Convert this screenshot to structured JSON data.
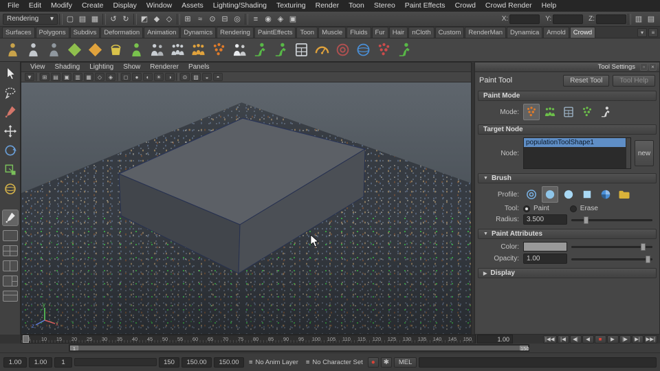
{
  "menubar": {
    "items": [
      "File",
      "Edit",
      "Modify",
      "Create",
      "Display",
      "Window",
      "Assets",
      "Lighting/Shading",
      "Texturing",
      "Render",
      "Toon",
      "Stereo",
      "Paint Effects",
      "Crowd",
      "Crowd Render",
      "Help"
    ]
  },
  "status": {
    "menu_mode": "Rendering",
    "menu_arrow": "▾",
    "icons": [
      {
        "name": "new-scene-icon",
        "g": "▢"
      },
      {
        "name": "open-scene-icon",
        "g": "▤"
      },
      {
        "name": "save-scene-icon",
        "g": "▦"
      },
      {
        "name": "divider",
        "div": true,
        "g": ""
      },
      {
        "name": "undo-icon",
        "g": "↺"
      },
      {
        "name": "redo-icon",
        "g": "↻"
      },
      {
        "name": "divider",
        "div": true,
        "g": ""
      },
      {
        "name": "select-hierarchy-icon",
        "g": "◩"
      },
      {
        "name": "select-object-icon",
        "g": "◆"
      },
      {
        "name": "select-component-icon",
        "g": "◇"
      },
      {
        "name": "divider",
        "div": true,
        "g": ""
      },
      {
        "name": "snap-grid-icon",
        "g": "⊞"
      },
      {
        "name": "snap-curve-icon",
        "g": "≈"
      },
      {
        "name": "snap-point-icon",
        "g": "⊙"
      },
      {
        "name": "snap-plane-icon",
        "g": "⊟"
      },
      {
        "name": "make-live-icon",
        "g": "◎"
      },
      {
        "name": "divider",
        "div": true,
        "g": ""
      },
      {
        "name": "history-icon",
        "g": "≡"
      },
      {
        "name": "render-current-icon",
        "g": "◉"
      },
      {
        "name": "ipr-render-icon",
        "g": "◈"
      },
      {
        "name": "render-settings-icon",
        "g": "▣"
      }
    ],
    "x_label": "X:",
    "y_label": "Y:",
    "z_label": "Z:",
    "x_value": "",
    "y_value": "",
    "z_value": "",
    "right_icons": [
      {
        "name": "show-sidebar-icon",
        "g": "▥"
      },
      {
        "name": "hide-sidebar-icon",
        "g": "▤"
      }
    ]
  },
  "shelf": {
    "tabs": [
      {
        "label": "Surfaces"
      },
      {
        "label": "Polygons"
      },
      {
        "label": "Subdivs"
      },
      {
        "label": "Deformation"
      },
      {
        "label": "Animation"
      },
      {
        "label": "Dynamics"
      },
      {
        "label": "Rendering"
      },
      {
        "label": "PaintEffects"
      },
      {
        "label": "Toon"
      },
      {
        "label": "Muscle"
      },
      {
        "label": "Fluids"
      },
      {
        "label": "Fur"
      },
      {
        "label": "Hair"
      },
      {
        "label": "nCloth"
      },
      {
        "label": "Custom"
      },
      {
        "label": "RenderMan"
      },
      {
        "label": "Dynamica"
      },
      {
        "label": "Arnold"
      },
      {
        "label": "Crowd",
        "active": true
      }
    ],
    "tab_buttons": [
      {
        "name": "shelf-menu-icon",
        "g": "▾"
      },
      {
        "name": "shelf-editor-icon",
        "g": "≡"
      }
    ],
    "icons": [
      {
        "name": "crowd-man-icon",
        "sym": "sym-person",
        "c": "#c8a24a"
      },
      {
        "name": "crowd-character-icon",
        "sym": "sym-person",
        "c": "#c3c8cd"
      },
      {
        "name": "crowd-skeleton-icon",
        "sym": "sym-person",
        "c": "#8f979e"
      },
      {
        "name": "terrain-diamond-icon",
        "sym": "sym-diamond",
        "c": "#8fbf4d"
      },
      {
        "name": "ground-diamond-icon",
        "sym": "sym-diamond",
        "c": "#e0a23c"
      },
      {
        "name": "paint-bucket-icon",
        "sym": "sym-bucket",
        "c": "#d9c24a"
      },
      {
        "name": "entity-green-icon",
        "sym": "sym-person",
        "c": "#79c24d"
      },
      {
        "name": "people-pair-icon",
        "sym": "sym-people",
        "c": "#c9ced3"
      },
      {
        "name": "people-group-icon",
        "sym": "sym-trio",
        "c": "#c9ced3"
      },
      {
        "name": "population-people-icon",
        "sym": "sym-trio",
        "c": "#e0a23c"
      },
      {
        "name": "dots-sphere-icon",
        "sym": "sym-dots",
        "c": "#e07b2a"
      },
      {
        "name": "people-white-icon",
        "sym": "sym-people",
        "c": "#e9ebee"
      },
      {
        "name": "walker-icon",
        "sym": "sym-runner",
        "c": "#58b847"
      },
      {
        "name": "runner-icon",
        "sym": "sym-runner",
        "c": "#58b847"
      },
      {
        "name": "calc-sheet-icon",
        "sym": "sym-calc",
        "c": "#ccd1d6"
      },
      {
        "name": "gauge-icon",
        "sym": "sym-gauge",
        "c": "#e0a23c"
      },
      {
        "name": "target-rings-icon",
        "sym": "sym-target",
        "c": "#b05050"
      },
      {
        "name": "sphere-orbit-icon",
        "sym": "sym-sphere",
        "c": "#4a90d9"
      },
      {
        "name": "burst-icon",
        "sym": "sym-dots",
        "c": "#cc4b4b"
      },
      {
        "name": "runner-trio-icon",
        "sym": "sym-runner",
        "c": "#58b847"
      }
    ]
  },
  "toolbox": {
    "tools": [
      {
        "name": "select-tool-icon",
        "sym": "sym-cursor",
        "c": "#e8e8e8"
      },
      {
        "name": "lasso-tool-icon",
        "sym": "sym-lasso",
        "c": "#dcdcdc"
      },
      {
        "name": "paint-select-tool-icon",
        "sym": "sym-brush",
        "c": "#d4766a"
      },
      {
        "name": "move-tool-icon",
        "sym": "sym-move",
        "c": "#d8d8d8"
      },
      {
        "name": "rotate-tool-icon",
        "sym": "sym-rotate",
        "c": "#6a9fd8"
      },
      {
        "name": "scale-tool-icon",
        "sym": "sym-scale",
        "c": "#7abf5a"
      },
      {
        "name": "universal-manip-tool-icon",
        "sym": "sym-sphere",
        "c": "#d8b54a"
      }
    ]
  },
  "viewport": {
    "menus": [
      "View",
      "Shading",
      "Lighting",
      "Show",
      "Renderer",
      "Panels"
    ],
    "toolbar": [
      {
        "name": "camera-menu-icon",
        "g": "▼"
      },
      {
        "name": "divider",
        "div": true,
        "g": ""
      },
      {
        "name": "grid-toggle-icon",
        "g": "⊞"
      },
      {
        "name": "film-gate-icon",
        "g": "▤"
      },
      {
        "name": "resolution-gate-icon",
        "g": "▣"
      },
      {
        "name": "gate-mask-icon",
        "g": "▥"
      },
      {
        "name": "field-chart-icon",
        "g": "▦"
      },
      {
        "name": "safe-action-icon",
        "g": "◇"
      },
      {
        "name": "safe-title-icon",
        "g": "◈"
      },
      {
        "name": "divider",
        "div": true,
        "g": ""
      },
      {
        "name": "wireframe-icon",
        "g": "◻"
      },
      {
        "name": "shaded-icon",
        "g": "●"
      },
      {
        "name": "textured-icon",
        "g": "◐"
      },
      {
        "name": "lights-icon",
        "g": "☀"
      },
      {
        "name": "shadows-icon",
        "g": "◑"
      },
      {
        "name": "divider",
        "div": true,
        "g": ""
      },
      {
        "name": "isolate-select-icon",
        "g": "⊙"
      },
      {
        "name": "xray-icon",
        "g": "▨"
      },
      {
        "name": "exposure-icon",
        "g": "◒"
      },
      {
        "name": "gamma-icon",
        "g": "◓"
      }
    ],
    "axis": {
      "x": "x",
      "y": "y",
      "z": "z"
    }
  },
  "tool_settings": {
    "window_title": "Tool Settings",
    "window_icons": [
      {
        "name": "restore-icon",
        "g": "▫"
      },
      {
        "name": "close-icon",
        "g": "×"
      }
    ],
    "tool_title": "Paint Tool",
    "reset_button": "Reset Tool",
    "help_button": "Tool Help",
    "paint_mode": {
      "header": "Paint Mode",
      "mode_label": "Mode:",
      "icons": [
        {
          "name": "paint-mode-place-icon",
          "sym": "sym-dots",
          "c": "#e07b2a",
          "active": true
        },
        {
          "name": "paint-mode-people-icon",
          "sym": "sym-trio",
          "c": "#6cbf4a"
        },
        {
          "name": "paint-mode-table-icon",
          "sym": "sym-calc",
          "c": "#9fb6c9"
        },
        {
          "name": "paint-mode-scatter-icon",
          "sym": "sym-dots",
          "c": "#6cbf4a"
        },
        {
          "name": "paint-mode-ball-icon",
          "sym": "sym-runner",
          "c": "#d8d8d8"
        }
      ]
    },
    "target_node": {
      "header": "Target Node",
      "node_label": "Node:",
      "selected_node": "populationToolShape1",
      "new_button": "new"
    },
    "brush": {
      "header": "Brush",
      "profile_label": "Profile:",
      "profile_icons": [
        {
          "name": "brush-gaussian-icon",
          "sym": "sym-target",
          "c": "#7ab4e8"
        },
        {
          "name": "brush-soft-icon",
          "sym": "sym-circle",
          "c": "#8fc6ea",
          "active": true
        },
        {
          "name": "brush-solid-icon",
          "sym": "sym-circle",
          "c": "#a8d8f4"
        },
        {
          "name": "brush-square-icon",
          "sym": "sym-square",
          "c": "#a8d8f4"
        },
        {
          "name": "brush-colorwheel-icon",
          "sym": "sym-wheel",
          "c": "#4a90d9"
        },
        {
          "name": "browse-folder-icon",
          "sym": "sym-folder",
          "c": "#d9b23a"
        }
      ],
      "tool_label": "Tool:",
      "paint_radio": "Paint",
      "erase_radio": "Erase",
      "radius_label": "Radius:",
      "radius_value": "3.500"
    },
    "paint_attributes": {
      "header": "Paint Attributes",
      "color_label": "Color:",
      "opacity_label": "Opacity:",
      "opacity_value": "1.00"
    },
    "display": {
      "header": "Display"
    }
  },
  "timeline": {
    "ticks": [
      5,
      10,
      15,
      20,
      25,
      30,
      35,
      40,
      45,
      50,
      55,
      60,
      65,
      70,
      75,
      80,
      85,
      90,
      95,
      100,
      105,
      110,
      115,
      120,
      125,
      130,
      135,
      140,
      145,
      150
    ],
    "current_time": "1.00"
  },
  "playback": {
    "buttons": [
      {
        "name": "go-to-start-button",
        "g": "|◀◀"
      },
      {
        "name": "step-back-key-button",
        "g": "|◀"
      },
      {
        "name": "step-back-frame-button",
        "g": "◀|"
      },
      {
        "name": "play-backwards-button",
        "g": "◀"
      },
      {
        "name": "record-button",
        "g": "■",
        "red": true
      },
      {
        "name": "play-forwards-button",
        "g": "▶"
      },
      {
        "name": "step-fwd-frame-button",
        "g": "|▶"
      },
      {
        "name": "step-fwd-key-button",
        "g": "▶|"
      },
      {
        "name": "go-to-end-button",
        "g": "▶▶|"
      }
    ]
  },
  "range": {
    "handle_start": "1",
    "handle_end": "150"
  },
  "bottom": {
    "anim_start": "1.00",
    "playback_start": "1.00",
    "range_start": "1",
    "range_end": "150",
    "playback_end": "150.00",
    "anim_end": "150.00",
    "anim_layer": "No Anim Layer",
    "char_set": "No Character Set",
    "menu_icon": "≡",
    "autokey_icon": "●",
    "prefs_icon": "✱",
    "mel_label": "MEL",
    "command_value": ""
  }
}
